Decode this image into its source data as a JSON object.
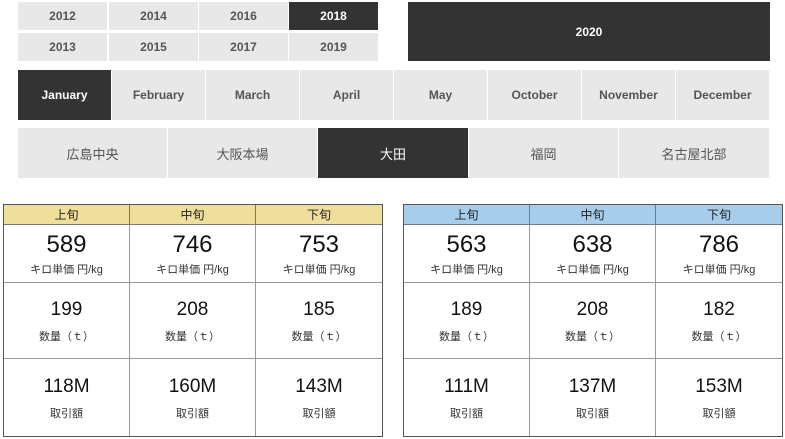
{
  "colors": {
    "active_bg": "#333333",
    "inactive_bg": "#e8e8e8",
    "left_header_bg": "#f0df9c",
    "right_header_bg": "#a7cdeb"
  },
  "years": {
    "row1": [
      "2012",
      "2014",
      "2016",
      "2018"
    ],
    "row2": [
      "2013",
      "2015",
      "2017",
      "2019"
    ],
    "big": "2020",
    "selected": "2018"
  },
  "months": [
    "January",
    "February",
    "March",
    "April",
    "May",
    "October",
    "November",
    "December"
  ],
  "selected_month": "January",
  "regions": [
    "広島中央",
    "大阪本場",
    "大田",
    "福岡",
    "名古屋北部"
  ],
  "selected_region": "大田",
  "labels": {
    "unit_price": "キロ単価 円/kg",
    "quantity": "数量（ｔ）",
    "amount": "取引額"
  },
  "left_panel": {
    "columns": [
      {
        "period": "上旬",
        "price": "589",
        "qty": "199",
        "amount": "118M"
      },
      {
        "period": "中旬",
        "price": "746",
        "qty": "208",
        "amount": "160M"
      },
      {
        "period": "下旬",
        "price": "753",
        "qty": "185",
        "amount": "143M"
      }
    ]
  },
  "right_panel": {
    "columns": [
      {
        "period": "上旬",
        "price": "563",
        "qty": "189",
        "amount": "111M"
      },
      {
        "period": "中旬",
        "price": "638",
        "qty": "208",
        "amount": "137M"
      },
      {
        "period": "下旬",
        "price": "786",
        "qty": "182",
        "amount": "153M"
      }
    ]
  }
}
